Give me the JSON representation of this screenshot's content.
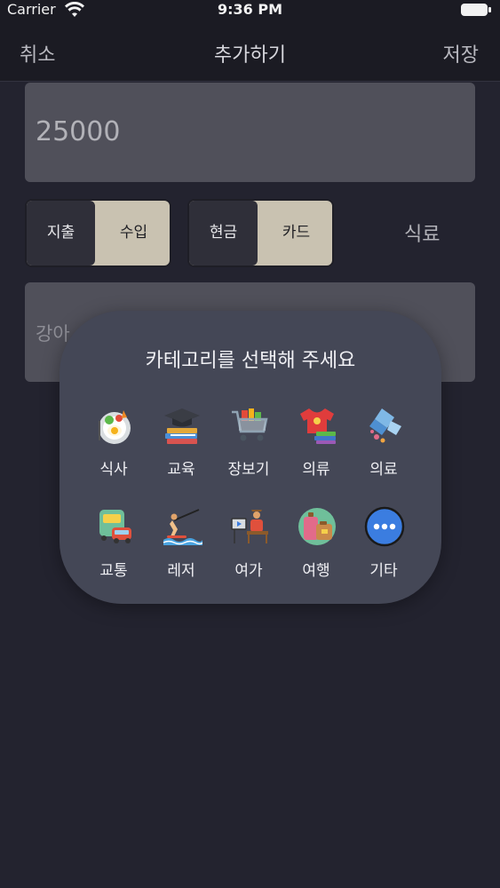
{
  "status_bar": {
    "carrier": "Carrier",
    "time": "9:36 PM"
  },
  "nav": {
    "cancel_label": "취소",
    "title": "추가하기",
    "save_label": "저장"
  },
  "form": {
    "amount": "25000",
    "type_options": [
      "지출",
      "수입"
    ],
    "payment_options": [
      "현금",
      "카드"
    ],
    "selected_category": "식료",
    "memo": "강아"
  },
  "category_picker": {
    "title": "카테고리를 선택해 주세요",
    "categories": [
      {
        "label": "식사",
        "icon": "meal-icon"
      },
      {
        "label": "교육",
        "icon": "education-icon"
      },
      {
        "label": "장보기",
        "icon": "shopping-cart-icon"
      },
      {
        "label": "의류",
        "icon": "clothing-icon"
      },
      {
        "label": "의료",
        "icon": "medical-icon"
      },
      {
        "label": "교통",
        "icon": "transport-icon"
      },
      {
        "label": "레저",
        "icon": "leisure-icon"
      },
      {
        "label": "여가",
        "icon": "hobby-icon"
      },
      {
        "label": "여행",
        "icon": "travel-icon"
      },
      {
        "label": "기타",
        "icon": "more-icon"
      }
    ]
  },
  "colors": {
    "background": "#23232f",
    "popup": "#444756",
    "segment": "#c9c2b1",
    "more_icon": "#3b7de0"
  }
}
